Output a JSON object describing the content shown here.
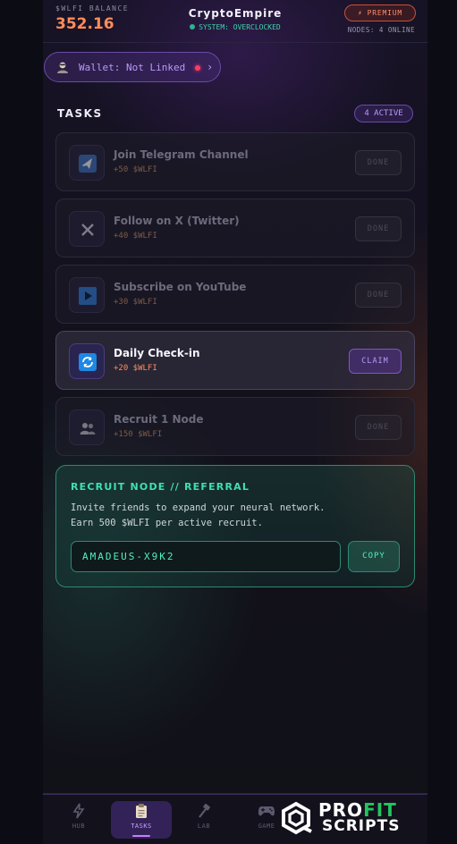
{
  "header": {
    "balance_label": "$WLFI BALANCE",
    "balance_value": "352.16",
    "app_title": "CryptoEmpire",
    "system_status": "SYSTEM: OVERCLOCKED",
    "premium_label": "PREMIUM",
    "nodes_status": "NODES: 4 ONLINE"
  },
  "wallet": {
    "label": "Wallet: Not Linked",
    "chevron": "›"
  },
  "tasks": {
    "title": "TASKS",
    "active_badge": "4 ACTIVE",
    "items": [
      {
        "name": "Join Telegram Channel",
        "reward": "+50 $WLFI",
        "action": "DONE",
        "icon": "telegram-plane-icon"
      },
      {
        "name": "Follow on X (Twitter)",
        "reward": "+40 $WLFI",
        "action": "DONE",
        "icon": "x-logo-icon"
      },
      {
        "name": "Subscribe on YouTube",
        "reward": "+30 $WLFI",
        "action": "DONE",
        "icon": "play-button-icon"
      },
      {
        "name": "Daily Check-in",
        "reward": "+20 $WLFI",
        "action": "CLAIM",
        "icon": "refresh-icon"
      },
      {
        "name": "Recruit 1 Node",
        "reward": "+150 $WLFI",
        "action": "DONE",
        "icon": "users-icon"
      }
    ]
  },
  "referral": {
    "title": "RECRUIT NODE // REFERRAL",
    "desc_line1": "Invite friends to expand your neural network.",
    "desc_line2": "Earn 500 $WLFI per active recruit.",
    "code": "AMADEUS-X9K2",
    "copy_label": "COPY"
  },
  "nav": {
    "items": [
      {
        "label": "HUB",
        "icon": "bolt-icon"
      },
      {
        "label": "TASKS",
        "icon": "clipboard-icon"
      },
      {
        "label": "LAB",
        "icon": "hammer-icon"
      },
      {
        "label": "GAME",
        "icon": "gamepad-icon"
      }
    ],
    "active": "TASKS"
  },
  "watermark": {
    "top_a": "PRO",
    "top_b": "FIT",
    "bottom": "SCRIPTS"
  },
  "colors": {
    "accent_purple": "#b99af8",
    "accent_orange": "#ff8c5a",
    "accent_green": "#3fe0b0",
    "alert_red": "#ff3b63"
  }
}
